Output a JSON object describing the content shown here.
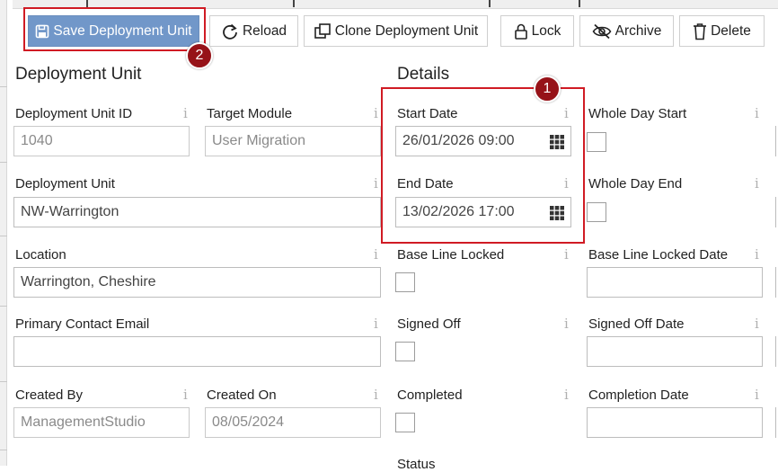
{
  "toolbar": {
    "save_label": "Save Deployment Unit",
    "reload_label": "Reload",
    "clone_label": "Clone Deployment Unit",
    "lock_label": "Lock",
    "archive_label": "Archive",
    "delete_label": "Delete"
  },
  "callouts": {
    "one": "1",
    "two": "2"
  },
  "info_glyph": "i",
  "deployment_unit": {
    "section_title": "Deployment Unit",
    "id_label": "Deployment Unit ID",
    "id_value": "1040",
    "target_module_label": "Target Module",
    "target_module_value": "User Migration",
    "name_label": "Deployment Unit",
    "name_value": "NW-Warrington",
    "location_label": "Location",
    "location_value": "Warrington, Cheshire",
    "contact_email_label": "Primary Contact Email",
    "contact_email_value": "",
    "created_by_label": "Created By",
    "created_by_value": "ManagementStudio",
    "created_on_label": "Created On",
    "created_on_value": "08/05/2024"
  },
  "details": {
    "section_title": "Details",
    "start_date_label": "Start Date",
    "start_date_value": "26/01/2026 09:00",
    "end_date_label": "End Date",
    "end_date_value": "13/02/2026 17:00",
    "whole_day_start_label": "Whole Day Start",
    "whole_day_start_checked": false,
    "whole_day_end_label": "Whole Day End",
    "whole_day_end_checked": false,
    "base_line_locked_label": "Base Line Locked",
    "base_line_locked_checked": false,
    "base_line_locked_date_label": "Base Line Locked Date",
    "base_line_locked_date_value": "",
    "signed_off_label": "Signed Off",
    "signed_off_checked": false,
    "signed_off_date_label": "Signed Off Date",
    "signed_off_date_value": "",
    "completed_label": "Completed",
    "completed_checked": false,
    "completion_date_label": "Completion Date",
    "completion_date_value": "",
    "status_label": "Status"
  },
  "colors": {
    "primary_button": "#7197c9",
    "callout_red": "#d01b24",
    "badge_red": "#961218"
  }
}
